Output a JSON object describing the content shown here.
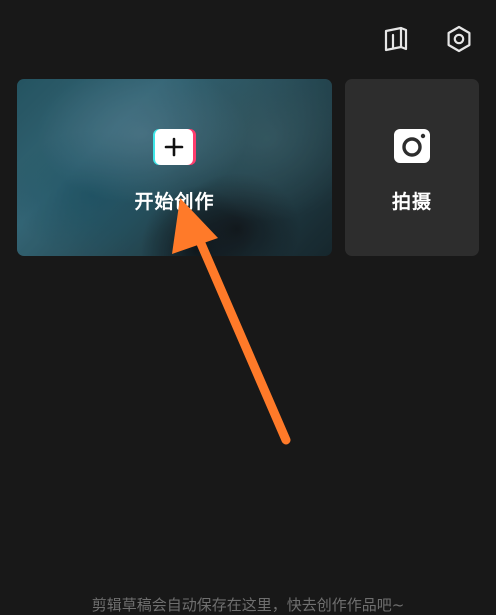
{
  "header": {
    "tutorial_icon": "tutorial-book-icon",
    "settings_icon": "settings-hexagon-icon"
  },
  "create_card": {
    "label": "开始创作",
    "icon": "plus-icon"
  },
  "shoot_card": {
    "label": "拍摄",
    "icon": "camera-icon"
  },
  "annotation": {
    "arrow_color": "#ff7a29"
  },
  "footer": {
    "hint": "剪辑草稿会自动保存在这里，快去创作作品吧~"
  },
  "colors": {
    "background": "#181818",
    "card": "#2d2d2d",
    "text": "#ffffff",
    "hint_text": "#6f6f6f"
  }
}
